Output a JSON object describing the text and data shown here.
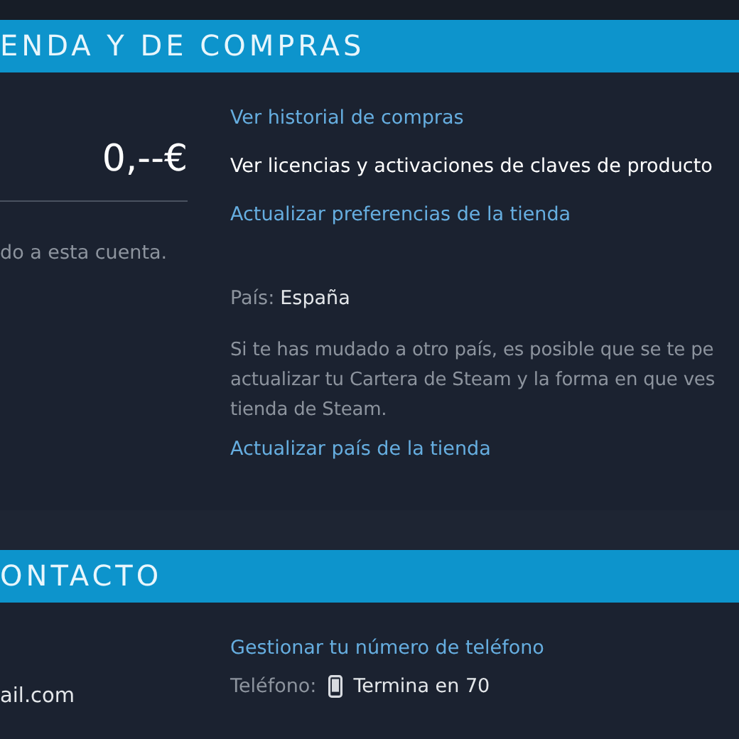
{
  "sections": [
    {
      "header": "ENDA Y DE COMPRAS",
      "left": {
        "amount": "0,--€",
        "note": "do a esta cuenta."
      },
      "links": [
        {
          "text": "Ver historial de compras",
          "hovered": false
        },
        {
          "text": "Ver licencias y activaciones de claves de producto",
          "hovered": true
        },
        {
          "text": "Actualizar preferencias de la tienda",
          "hovered": false
        }
      ],
      "country": {
        "label": "País:",
        "value": "España"
      },
      "info_lines": [
        "Si te has mudado a otro país, es posible que se te pe",
        "actualizar tu Cartera de Steam y la forma en que ves",
        "tienda de Steam."
      ],
      "country_link": "Actualizar país de la tienda"
    },
    {
      "header": "ONTACTO",
      "left": {
        "email": "ail.com"
      },
      "links": [
        {
          "text": "Gestionar tu número de teléfono",
          "hovered": false
        }
      ],
      "phone": {
        "label": "Teléfono:",
        "value": "Termina en 70"
      }
    }
  ]
}
